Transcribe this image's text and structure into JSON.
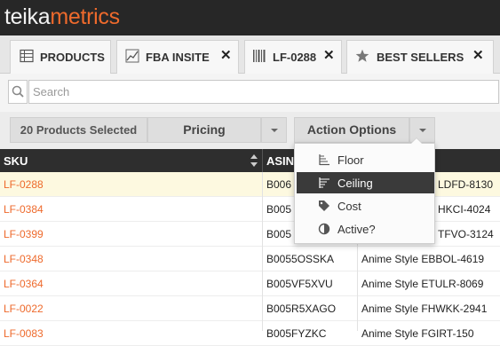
{
  "brand": {
    "part1": "teika",
    "part2": "metrics"
  },
  "tabs": [
    {
      "label": "PRODUCTS",
      "icon": "grid-icon"
    },
    {
      "label": "FBA INSITE",
      "icon": "chart-icon",
      "close": "✕"
    },
    {
      "label": "LF-0288",
      "icon": "barcode-icon",
      "close": "✕"
    },
    {
      "label": "BEST SELLERS",
      "icon": "star-icon",
      "close": "✕"
    }
  ],
  "search": {
    "placeholder": "Search",
    "value": ""
  },
  "toolbar": {
    "selected_label": "20 Products Selected",
    "pricing_label": "Pricing",
    "action_label": "Action Options"
  },
  "table": {
    "columns": [
      "SKU",
      "ASIN"
    ],
    "rows": [
      {
        "sku": "LF-0288",
        "asin": "B006",
        "title": "LDFD-8130"
      },
      {
        "sku": "LF-0384",
        "asin": "B005",
        "title": "HKCI-4024"
      },
      {
        "sku": "LF-0399",
        "asin": "B005",
        "title": "TFVO-3124"
      },
      {
        "sku": "LF-0348",
        "asin": "B0055OSSKA",
        "title": "Anime Style EBBOL-4619"
      },
      {
        "sku": "LF-0364",
        "asin": "B005VF5XVU",
        "title": "Anime Style ETULR-8069"
      },
      {
        "sku": "LF-0022",
        "asin": "B005R5XAGO",
        "title": "Anime Style FHWKK-2941"
      },
      {
        "sku": "LF-0083",
        "asin": "B005FYZKC",
        "title": "Anime Style FGIRT-150"
      }
    ]
  },
  "menu": {
    "items": [
      {
        "label": "Floor",
        "icon": "floor-icon"
      },
      {
        "label": "Ceiling",
        "icon": "ceiling-icon"
      },
      {
        "label": "Cost",
        "icon": "tag-icon"
      },
      {
        "label": "Active?",
        "icon": "contrast-icon"
      }
    ]
  },
  "colors": {
    "brand_accent": "#ee6a2c",
    "topbar": "#272727",
    "header": "#2e2e2e"
  }
}
